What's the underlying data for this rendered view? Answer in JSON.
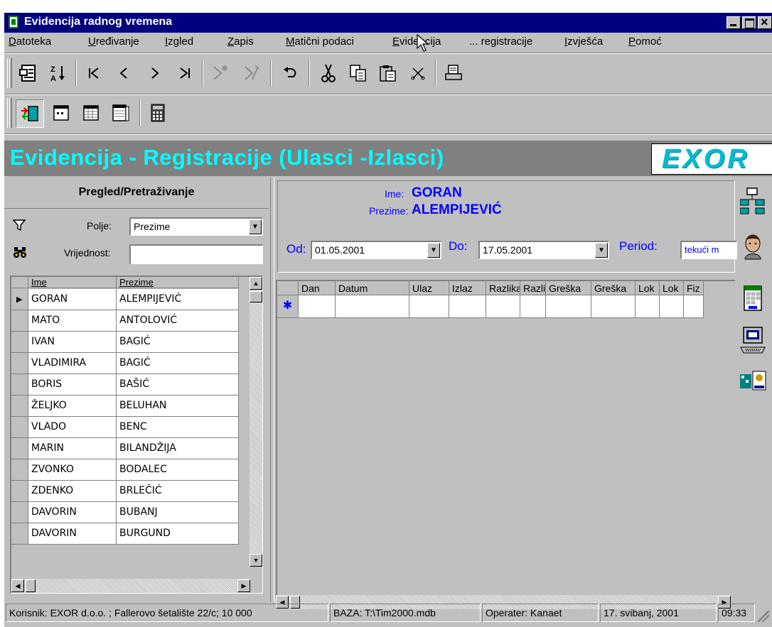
{
  "window": {
    "title": "Evidencija radnog vremena"
  },
  "menu": [
    {
      "label": "Datoteka",
      "u": "D",
      "rest": "atoteka"
    },
    {
      "label": "Uređivanje",
      "u": "U",
      "rest": "ređivanje"
    },
    {
      "label": "Izgled",
      "u": "I",
      "rest": "zgled"
    },
    {
      "label": "Zapis",
      "u": "Z",
      "rest": "apis"
    },
    {
      "label": "Matični podaci",
      "u": "M",
      "rest": "atični podaci"
    },
    {
      "label": "Evidencija",
      "u": "E",
      "rest": "videncija"
    },
    {
      "label": "... registracije",
      "u": "",
      "rest": "... registracije"
    },
    {
      "label": "Izvješća",
      "u": "I",
      "rest": "zvješća"
    },
    {
      "label": "Pomoć",
      "u": "P",
      "rest": "omoć"
    }
  ],
  "banner": {
    "heading": "Evidencija - Registracije (Ulasci -Izlasci)",
    "logo": "EXOR"
  },
  "search": {
    "title": "Pregled/Pretraživanje",
    "field_label": "Polje:",
    "field_value": "Prezime",
    "value_label": "Vrijednost:",
    "value_text": ""
  },
  "people": {
    "headers": [
      "Ime",
      "Prezime"
    ],
    "rows": [
      [
        "GORAN",
        "ALEMPIJEVIĆ"
      ],
      [
        "MATO",
        "ANTOLOVIĆ"
      ],
      [
        "IVAN",
        "BAGIĆ"
      ],
      [
        "VLADIMIRA",
        "BAGIĆ"
      ],
      [
        "BORIS",
        "BAŠIĆ"
      ],
      [
        "ŽELJKO",
        "BELUHAN"
      ],
      [
        "VLADO",
        "BENC"
      ],
      [
        "MARIN",
        "BILANDŽIJA"
      ],
      [
        "ZVONKO",
        "BODALEC"
      ],
      [
        "ZDENKO",
        "BRLEČIĆ"
      ],
      [
        "DAVORIN",
        "BUBANJ"
      ],
      [
        "DAVORIN",
        "BURGUND"
      ]
    ],
    "selected_index": 0
  },
  "person": {
    "ime_label": "Ime:",
    "ime": "GORAN",
    "prezime_label": "Prezime:",
    "prezime": "ALEMPIJEVIĆ"
  },
  "range": {
    "od_label": "Od:",
    "od": "01.05.2001",
    "do_label": "Do:",
    "do": "17.05.2001",
    "period_label": "Period:",
    "period": "tekući m"
  },
  "registrations": {
    "headers": [
      "Dan",
      "Datum",
      "Ulaz",
      "Izlaz",
      "Razlika",
      "Razlika",
      "Greška",
      "Greška",
      "Lok",
      "Lok",
      "Fiz"
    ],
    "new_row_marker": "✱"
  },
  "status": {
    "user": "Korisnik: EXOR d.o.o. ; Fallerovo šetalište 22/c; 10 000",
    "db": "BAZA: T:\\Tim2000.mdb",
    "operator": "Operater: Kanaet",
    "date": "17. svibanj, 2001",
    "time": "09:33"
  },
  "colors": {
    "titlebar": "#000080",
    "banner_bg": "#808080",
    "banner_text": "#00ffff",
    "accent_blue": "#0000ff",
    "face": "#c0c0c0"
  }
}
